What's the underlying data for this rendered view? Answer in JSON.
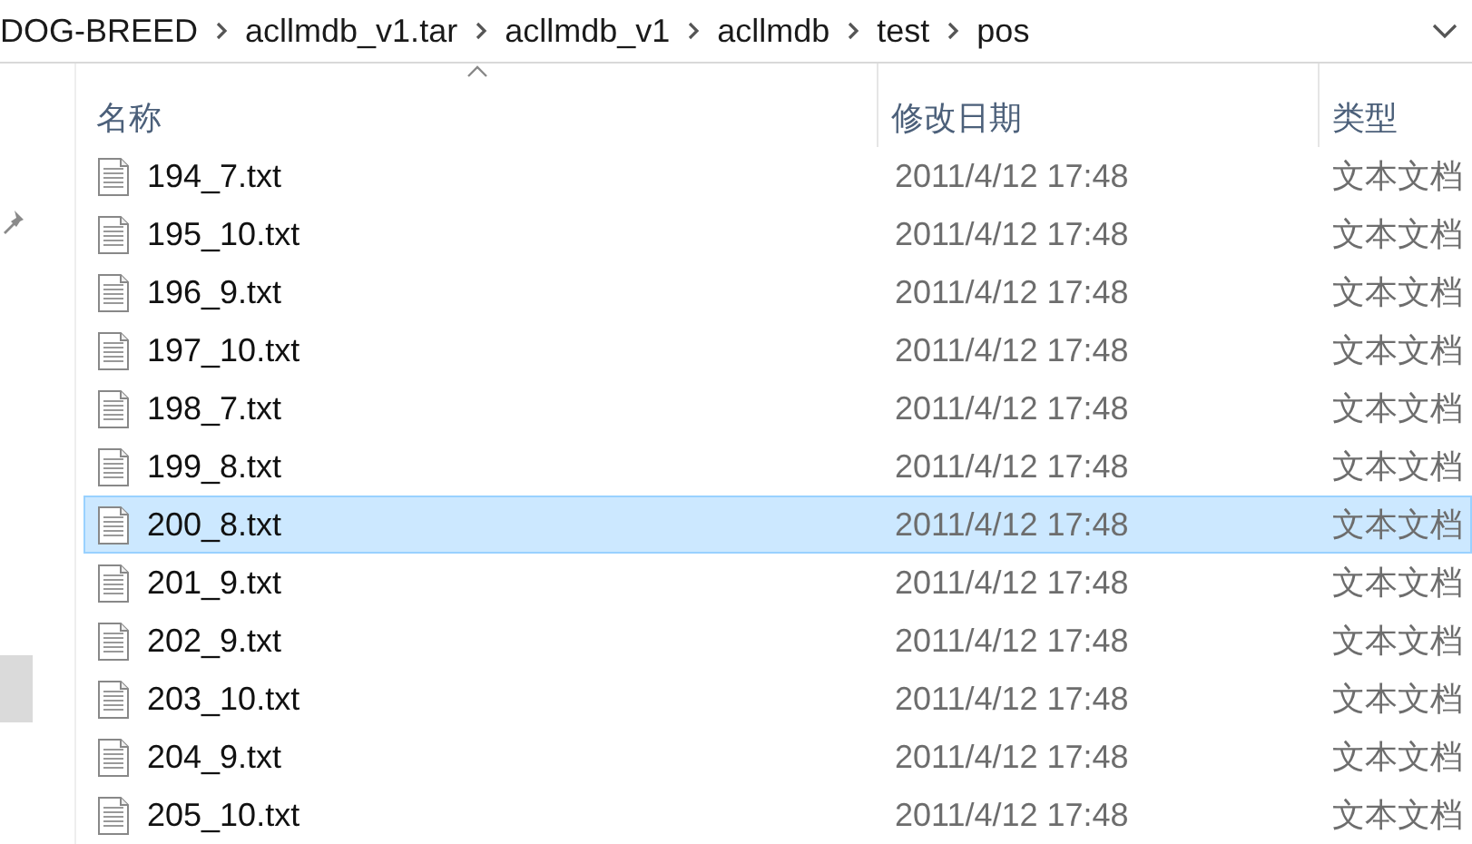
{
  "breadcrumb": [
    "DOG-BREED",
    "acllmdb_v1.tar",
    "acllmdb_v1",
    "acllmdb",
    "test",
    "pos"
  ],
  "columns": [
    {
      "label": "名称",
      "sorted": true
    },
    {
      "label": "修改日期",
      "sorted": false
    },
    {
      "label": "类型",
      "sorted": false
    }
  ],
  "files": [
    {
      "name": "194_7.txt",
      "date": "2011/4/12 17:48",
      "type": "文本文档",
      "selected": false
    },
    {
      "name": "195_10.txt",
      "date": "2011/4/12 17:48",
      "type": "文本文档",
      "selected": false
    },
    {
      "name": "196_9.txt",
      "date": "2011/4/12 17:48",
      "type": "文本文档",
      "selected": false
    },
    {
      "name": "197_10.txt",
      "date": "2011/4/12 17:48",
      "type": "文本文档",
      "selected": false
    },
    {
      "name": "198_7.txt",
      "date": "2011/4/12 17:48",
      "type": "文本文档",
      "selected": false
    },
    {
      "name": "199_8.txt",
      "date": "2011/4/12 17:48",
      "type": "文本文档",
      "selected": false
    },
    {
      "name": "200_8.txt",
      "date": "2011/4/12 17:48",
      "type": "文本文档",
      "selected": true
    },
    {
      "name": "201_9.txt",
      "date": "2011/4/12 17:48",
      "type": "文本文档",
      "selected": false
    },
    {
      "name": "202_9.txt",
      "date": "2011/4/12 17:48",
      "type": "文本文档",
      "selected": false
    },
    {
      "name": "203_10.txt",
      "date": "2011/4/12 17:48",
      "type": "文本文档",
      "selected": false
    },
    {
      "name": "204_9.txt",
      "date": "2011/4/12 17:48",
      "type": "文本文档",
      "selected": false
    },
    {
      "name": "205_10.txt",
      "date": "2011/4/12 17:48",
      "type": "文本文档",
      "selected": false
    }
  ]
}
